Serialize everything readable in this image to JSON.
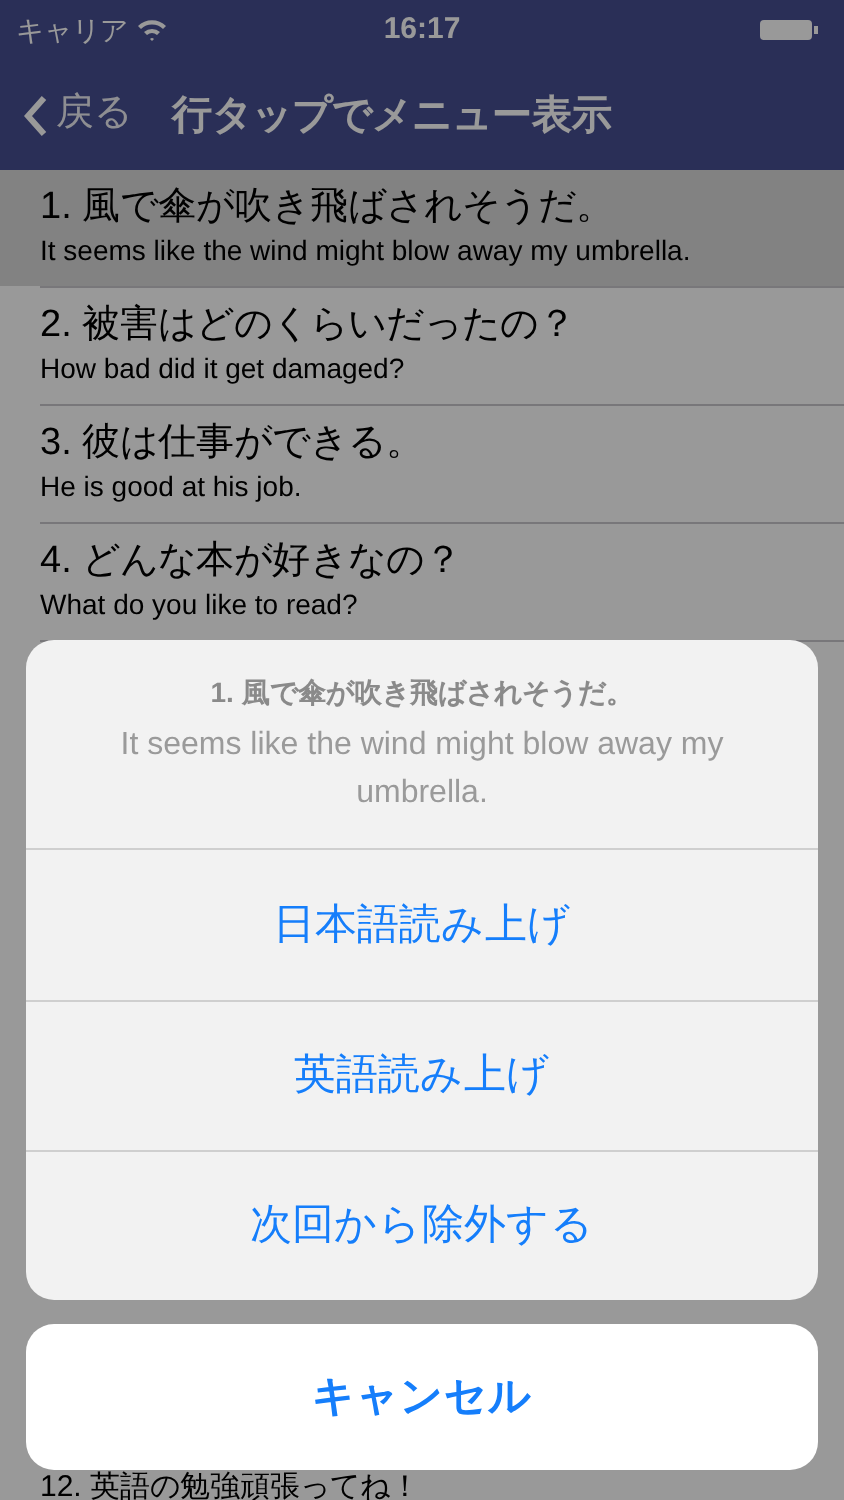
{
  "status_bar": {
    "carrier": "キャリア",
    "time": "16:17"
  },
  "nav_bar": {
    "back": "戻る",
    "title": "行タップでメニュー表示"
  },
  "rows": [
    {
      "japanese": "1. 風で傘が吹き飛ばされそうだ。",
      "english": "It seems like the wind might blow away my umbrella.",
      "selected": true
    },
    {
      "japanese": "2. 被害はどのくらいだったの？",
      "english": "How bad did it get damaged?",
      "selected": false
    },
    {
      "japanese": "3. 彼は仕事ができる。",
      "english": "He is good at his job.",
      "selected": false
    },
    {
      "japanese": "4. どんな本が好きなの？",
      "english": "What do you like to read?",
      "selected": false
    },
    {
      "japanese": "12. 英語の勉強頑張ってね！",
      "selected": false
    }
  ],
  "action_sheet": {
    "title": "1. 風で傘が吹き飛ばされそうだ。",
    "message": "It seems like the wind might blow away my umbrella.",
    "actions": [
      "日本語読み上げ",
      "英語読み上げ",
      "次回から除外する"
    ],
    "cancel": "キャンセル"
  }
}
